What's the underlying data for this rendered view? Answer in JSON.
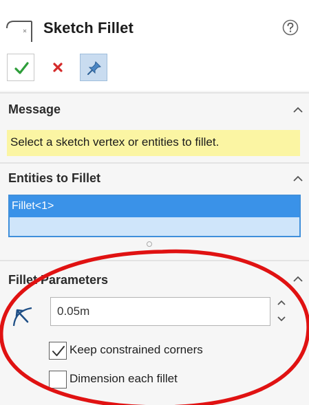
{
  "header": {
    "title": "Sketch Fillet",
    "feature_icon": "sketch-fillet-icon",
    "help_icon": "help-icon",
    "buttons": {
      "ok_icon": "checkmark-icon",
      "cancel_icon": "close-icon",
      "pin_icon": "pushpin-icon"
    }
  },
  "message_group": {
    "title": "Message",
    "text": "Select a sketch vertex or entities to fillet."
  },
  "entities_group": {
    "title": "Entities to Fillet",
    "items": [
      "Fillet<1>"
    ]
  },
  "parameters_group": {
    "title": "Fillet Parameters",
    "radius_value": "0.05m",
    "radius_icon": "fillet-radius-icon",
    "keep_corners": {
      "label": "Keep constrained corners",
      "checked": true
    },
    "dimension_each": {
      "label": "Dimension each fillet",
      "checked": false
    }
  },
  "colors": {
    "accent": "#3a92e8",
    "message_bg": "#fbf5a3",
    "ok_green": "#2e9e3a",
    "cancel_red": "#d42a2a",
    "annotation_red": "#e01212"
  }
}
